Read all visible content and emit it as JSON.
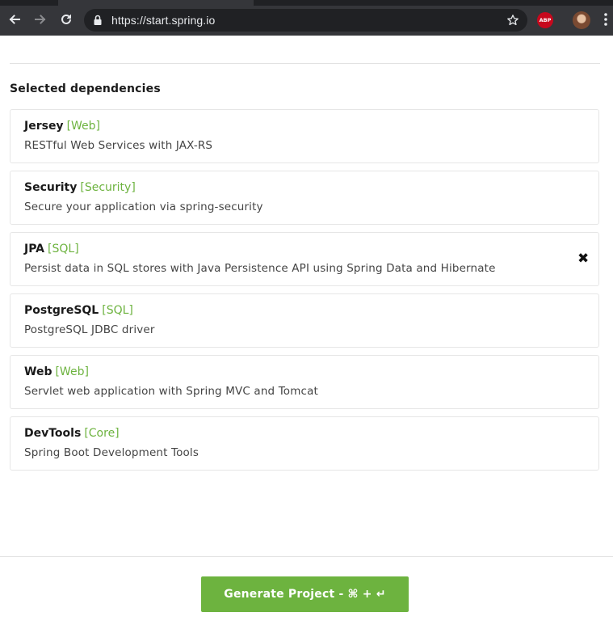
{
  "browser": {
    "url": "https://start.spring.io",
    "icons": {
      "back": "arrow-left-icon",
      "forward": "arrow-right-icon",
      "reload": "reload-icon",
      "secure": "lock-icon",
      "bookmark": "star-icon",
      "menu": "kebab-menu-icon"
    },
    "extension_label": "ABP"
  },
  "section": {
    "title": "Selected dependencies"
  },
  "dependencies": [
    {
      "name": "Jersey",
      "group": "[Web]",
      "description": "RESTful Web Services with JAX-RS"
    },
    {
      "name": "Security",
      "group": "[Security]",
      "description": "Secure your application via spring-security"
    },
    {
      "name": "JPA",
      "group": "[SQL]",
      "description": "Persist data in SQL stores with Java Persistence API using Spring Data and Hibernate",
      "remove_label": "✖"
    },
    {
      "name": "PostgreSQL",
      "group": "[SQL]",
      "description": "PostgreSQL JDBC driver"
    },
    {
      "name": "Web",
      "group": "[Web]",
      "description": "Servlet web application with Spring MVC and Tomcat"
    },
    {
      "name": "DevTools",
      "group": "[Core]",
      "description": "Spring Boot Development Tools"
    }
  ],
  "footer": {
    "generate_label": "Generate Project - ⌘ + ↵"
  },
  "colors": {
    "accent": "#6db33f",
    "chrome": "#35363a",
    "omnibox": "#202124"
  }
}
